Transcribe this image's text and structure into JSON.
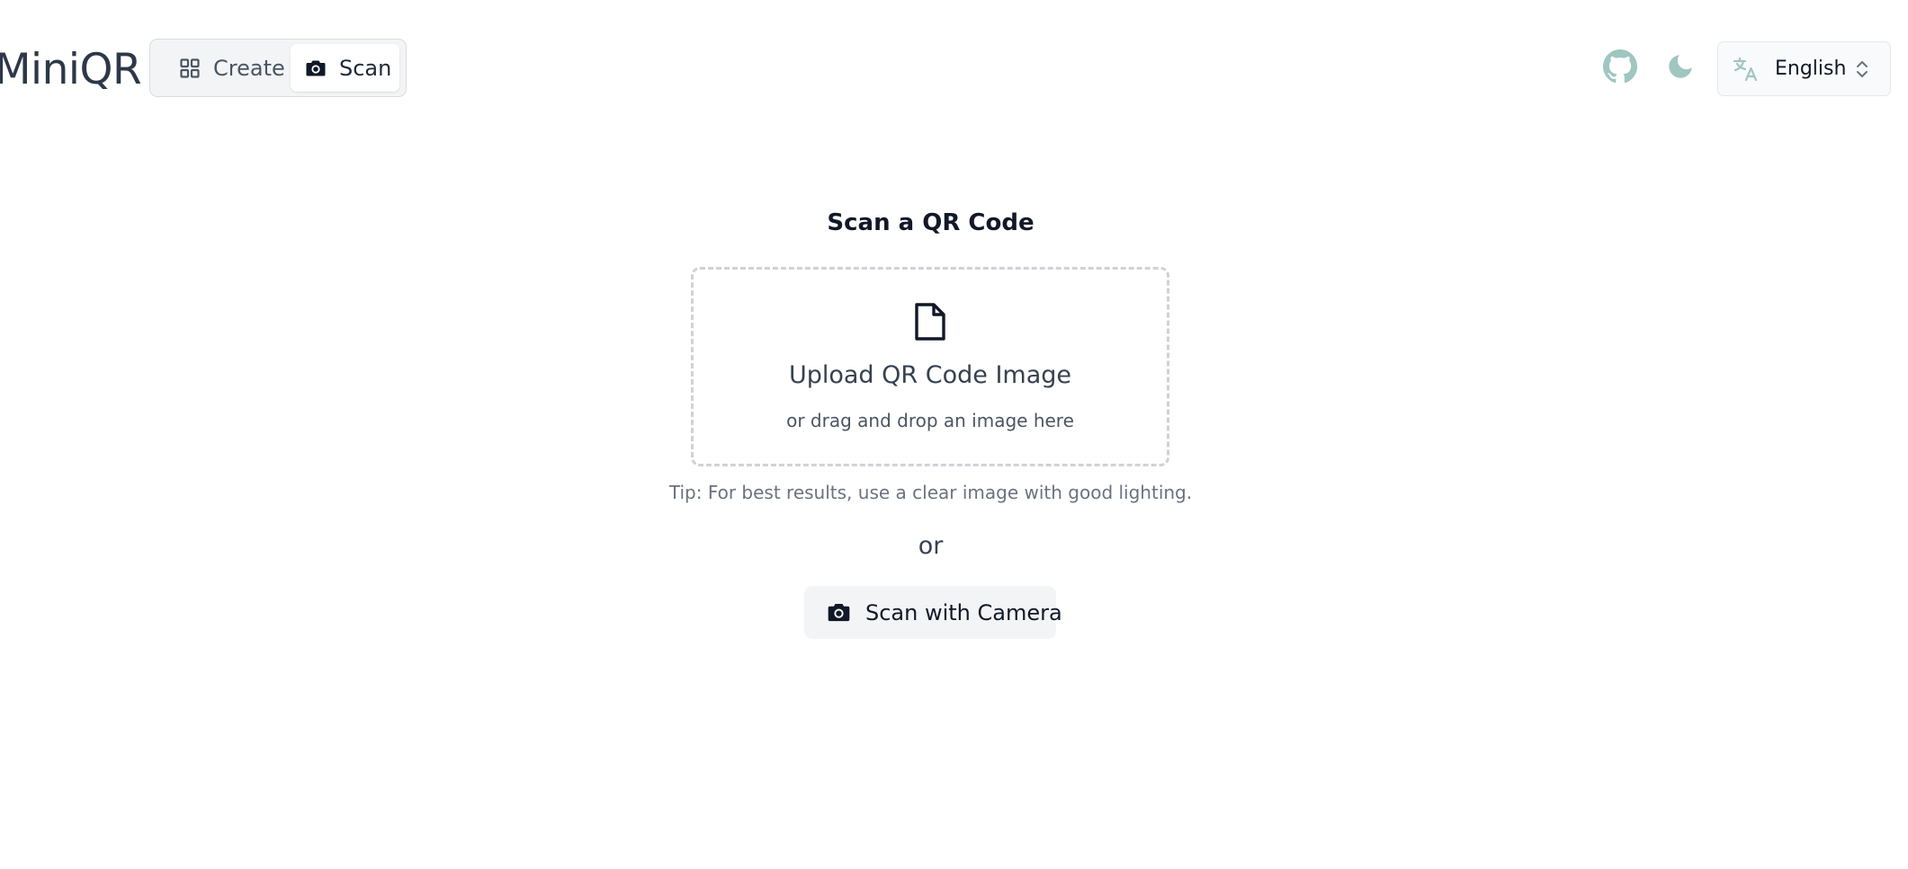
{
  "header": {
    "logo": "MiniQR",
    "modes": [
      {
        "label": "Create",
        "icon": "grid-icon",
        "active": false
      },
      {
        "label": "Scan",
        "icon": "camera-icon",
        "active": true
      }
    ],
    "github_icon": "github-icon",
    "theme_icon": "moon-icon",
    "language": {
      "selected": "English",
      "icon": "translate-icon"
    }
  },
  "main": {
    "title": "Scan a QR Code",
    "upload": {
      "icon": "file-icon",
      "title": "Upload QR Code Image",
      "subtitle": "or drag and drop an image here"
    },
    "tip": "Tip: For best results, use a clear image with good lighting.",
    "or_label": "or",
    "camera_button": "Scan with Camera"
  },
  "colors": {
    "accent_icon": "#9fc6c0",
    "text_dark": "#111827",
    "muted": "#6b7280",
    "surface": "#f3f4f6"
  }
}
